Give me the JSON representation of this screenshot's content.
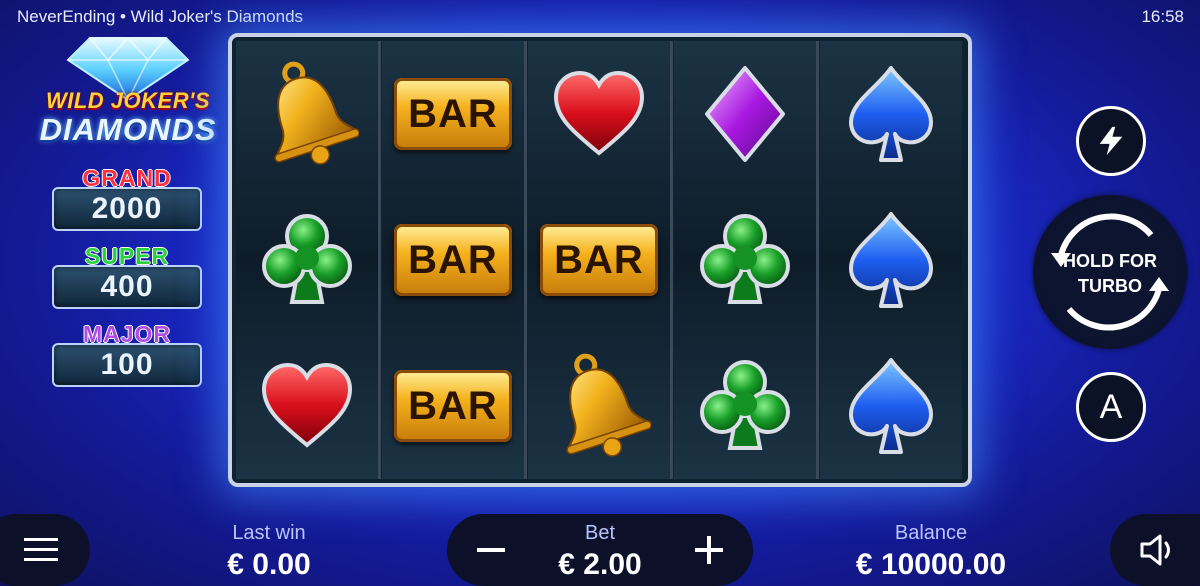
{
  "app": {
    "title": "NeverEnding • Wild Joker's Diamonds",
    "clock": "16:58"
  },
  "logo": {
    "line1": "WILD JOKER'S",
    "line2": "DIAMONDS"
  },
  "jackpots": [
    {
      "name": "GRAND",
      "value": "2000"
    },
    {
      "name": "SUPER",
      "value": "400"
    },
    {
      "name": "MAJOR",
      "value": "100"
    }
  ],
  "reels": [
    [
      "bell",
      "club",
      "heart"
    ],
    [
      "bar",
      "bar",
      "bar"
    ],
    [
      "heart",
      "bar",
      "bell"
    ],
    [
      "diamond",
      "club",
      "club"
    ],
    [
      "spade",
      "spade",
      "spade"
    ]
  ],
  "symbol_text": {
    "bar": "BAR"
  },
  "controls": {
    "turbo_icon": "lightning-icon",
    "spin_line1": "HOLD FOR",
    "spin_line2": "TURBO",
    "autoplay_label": "A"
  },
  "bottom": {
    "last_win_label": "Last win",
    "last_win_value": "€ 0.00",
    "bet_label": "Bet",
    "bet_value": "€ 2.00",
    "minus": "−",
    "plus": "+",
    "balance_label": "Balance",
    "balance_value": "€ 10000.00"
  },
  "colors": {
    "background": "#1b2fd9",
    "reel_bg": "#0f2230",
    "grand": "#ff2f3f",
    "super": "#27d23a",
    "major": "#b04be4"
  }
}
